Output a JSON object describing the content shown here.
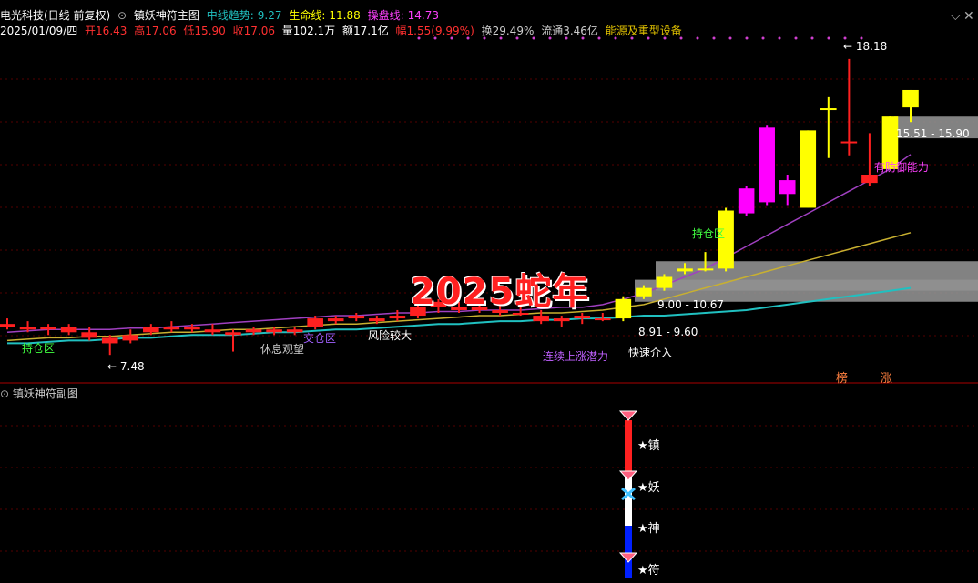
{
  "header": {
    "stock": "电光科技(日线 前复权)",
    "indicator": "镇妖神符主图",
    "mid_trend_label": "中线趋势:",
    "mid_trend_value": "9.27",
    "life_label": "生命线:",
    "life_value": "11.88",
    "op_label": "操盘线:",
    "op_value": "14.73",
    "date": "2025/01/09/四",
    "open": "开16.43",
    "high": "高17.06",
    "low": "低15.90",
    "close": "收17.06",
    "volume": "量102.1万",
    "amount": "额17.1亿",
    "change": "幅1.55(9.99%)",
    "turnover": "换29.49%",
    "float": "流通3.46亿",
    "sector": "能源及重型设备"
  },
  "sub_title": "镇妖神符副图",
  "watermark": "2025蛇年",
  "annotations": {
    "hold_zone_left": "持仓区",
    "hold_zone_right": "持仓区",
    "rest_wait": "休息观望",
    "cross_zone": "交仓区",
    "risk_up": "风险较大",
    "strong_entry": "快速介入",
    "pos_label": "连续上涨潜力",
    "defense": "有防御能力",
    "lowest": "7.48",
    "peak": "18.18",
    "zone_top": "15.51 - 15.90",
    "zone_mid": "9.00 - 10.67",
    "zone_low": "8.91 - 9.60",
    "tag_bang": "榜",
    "tag_zhang": "涨"
  },
  "stars": [
    "★镇",
    "★妖",
    "★神",
    "★符"
  ],
  "colors": {
    "up": "#ff2020",
    "down": "#00c0c0",
    "yellow": "#ffff00",
    "magenta": "#ff00ff",
    "cyan_line": "#20c0c0",
    "gold_line": "#c8b030",
    "purple_line": "#a040c0"
  },
  "chart_data": {
    "type": "candlestick",
    "title": "镇妖神符主图",
    "ylim": [
      6.5,
      19
    ],
    "candles": [
      {
        "o": 8.6,
        "h": 8.8,
        "l": 8.4,
        "c": 8.5,
        "col": "red"
      },
      {
        "o": 8.5,
        "h": 8.7,
        "l": 8.3,
        "c": 8.4,
        "col": "red"
      },
      {
        "o": 8.4,
        "h": 8.6,
        "l": 8.2,
        "c": 8.5,
        "col": "red"
      },
      {
        "o": 8.5,
        "h": 8.6,
        "l": 8.2,
        "c": 8.3,
        "col": "red"
      },
      {
        "o": 8.3,
        "h": 8.5,
        "l": 8.0,
        "c": 8.1,
        "col": "red"
      },
      {
        "o": 8.1,
        "h": 8.2,
        "l": 7.48,
        "c": 7.9,
        "col": "red"
      },
      {
        "o": 8.2,
        "h": 8.4,
        "l": 7.9,
        "c": 8.0,
        "col": "red"
      },
      {
        "o": 8.3,
        "h": 8.6,
        "l": 8.2,
        "c": 8.5,
        "col": "red"
      },
      {
        "o": 8.5,
        "h": 8.7,
        "l": 8.3,
        "c": 8.4,
        "col": "red"
      },
      {
        "o": 8.5,
        "h": 8.6,
        "l": 8.3,
        "c": 8.4,
        "col": "red"
      },
      {
        "o": 8.4,
        "h": 8.6,
        "l": 8.2,
        "c": 8.3,
        "col": "red"
      },
      {
        "o": 8.3,
        "h": 8.4,
        "l": 7.6,
        "c": 8.2,
        "col": "red"
      },
      {
        "o": 8.3,
        "h": 8.5,
        "l": 8.2,
        "c": 8.4,
        "col": "red"
      },
      {
        "o": 8.4,
        "h": 8.5,
        "l": 8.2,
        "c": 8.3,
        "col": "red"
      },
      {
        "o": 8.3,
        "h": 8.5,
        "l": 8.2,
        "c": 8.4,
        "col": "red"
      },
      {
        "o": 8.5,
        "h": 8.9,
        "l": 8.4,
        "c": 8.8,
        "col": "red"
      },
      {
        "o": 8.7,
        "h": 8.9,
        "l": 8.6,
        "c": 8.8,
        "col": "red"
      },
      {
        "o": 8.8,
        "h": 9.0,
        "l": 8.7,
        "c": 8.9,
        "col": "red"
      },
      {
        "o": 8.7,
        "h": 8.9,
        "l": 8.6,
        "c": 8.8,
        "col": "red"
      },
      {
        "o": 8.8,
        "h": 9.1,
        "l": 8.7,
        "c": 8.9,
        "col": "red"
      },
      {
        "o": 8.9,
        "h": 9.3,
        "l": 8.8,
        "c": 9.2,
        "col": "red"
      },
      {
        "o": 9.2,
        "h": 9.5,
        "l": 9.0,
        "c": 9.4,
        "col": "red"
      },
      {
        "o": 9.2,
        "h": 9.4,
        "l": 9.0,
        "c": 9.1,
        "col": "red"
      },
      {
        "o": 9.1,
        "h": 9.3,
        "l": 9.0,
        "c": 9.2,
        "col": "red"
      },
      {
        "o": 9.0,
        "h": 9.3,
        "l": 8.9,
        "c": 9.1,
        "col": "red"
      },
      {
        "o": 9.0,
        "h": 9.2,
        "l": 8.9,
        "c": 9.0,
        "col": "red"
      },
      {
        "o": 8.9,
        "h": 9.1,
        "l": 8.6,
        "c": 8.7,
        "col": "red"
      },
      {
        "o": 8.7,
        "h": 8.9,
        "l": 8.5,
        "c": 8.8,
        "col": "red"
      },
      {
        "o": 8.8,
        "h": 9.0,
        "l": 8.6,
        "c": 8.9,
        "col": "red"
      },
      {
        "o": 8.8,
        "h": 9.0,
        "l": 8.7,
        "c": 8.8,
        "col": "red"
      },
      {
        "o": 8.8,
        "h": 9.6,
        "l": 8.7,
        "c": 9.5,
        "col": "yellow"
      },
      {
        "o": 9.6,
        "h": 10.0,
        "l": 9.5,
        "c": 9.9,
        "col": "yellow"
      },
      {
        "o": 9.9,
        "h": 10.4,
        "l": 9.8,
        "c": 10.3,
        "col": "yellow"
      },
      {
        "o": 10.5,
        "h": 10.8,
        "l": 10.4,
        "c": 10.6,
        "col": "yellow"
      },
      {
        "o": 10.6,
        "h": 11.2,
        "l": 10.5,
        "c": 10.6,
        "col": "yellow"
      },
      {
        "o": 10.6,
        "h": 12.8,
        "l": 10.5,
        "c": 12.7,
        "col": "yellow"
      },
      {
        "o": 12.6,
        "h": 13.6,
        "l": 12.5,
        "c": 13.5,
        "col": "magenta"
      },
      {
        "o": 13.0,
        "h": 15.8,
        "l": 12.9,
        "c": 15.7,
        "col": "magenta"
      },
      {
        "o": 13.3,
        "h": 14.0,
        "l": 12.9,
        "c": 13.8,
        "col": "magenta"
      },
      {
        "o": 12.8,
        "h": 15.6,
        "l": 12.8,
        "c": 15.6,
        "col": "yellow"
      },
      {
        "o": 16.4,
        "h": 16.8,
        "l": 14.6,
        "c": 16.4,
        "col": "yellow"
      },
      {
        "o": 15.2,
        "h": 18.18,
        "l": 14.7,
        "c": 15.2,
        "col": "red"
      },
      {
        "o": 14.0,
        "h": 15.5,
        "l": 13.6,
        "c": 13.7,
        "col": "red"
      },
      {
        "o": 14.2,
        "h": 16.1,
        "l": 14.2,
        "c": 16.1,
        "col": "yellow"
      },
      {
        "o": 16.43,
        "h": 17.06,
        "l": 15.9,
        "c": 17.06,
        "col": "yellow"
      }
    ],
    "lines": {
      "cyan": [
        7.9,
        7.9,
        7.95,
        8.0,
        8.0,
        8.05,
        8.1,
        8.1,
        8.15,
        8.2,
        8.2,
        8.2,
        8.25,
        8.3,
        8.3,
        8.35,
        8.4,
        8.4,
        8.45,
        8.5,
        8.55,
        8.6,
        8.6,
        8.65,
        8.7,
        8.7,
        8.75,
        8.75,
        8.8,
        8.8,
        8.85,
        8.9,
        8.9,
        8.95,
        9.0,
        9.05,
        9.1,
        9.2,
        9.3,
        9.4,
        9.5,
        9.6,
        9.7,
        9.8,
        9.9
      ],
      "gold": [
        8.0,
        8.05,
        8.1,
        8.1,
        8.15,
        8.15,
        8.2,
        8.25,
        8.3,
        8.3,
        8.35,
        8.4,
        8.4,
        8.45,
        8.5,
        8.55,
        8.6,
        8.6,
        8.65,
        8.7,
        8.75,
        8.8,
        8.85,
        8.9,
        8.9,
        8.95,
        9.0,
        9.0,
        9.05,
        9.1,
        9.2,
        9.3,
        9.5,
        9.7,
        9.9,
        10.1,
        10.3,
        10.5,
        10.7,
        10.9,
        11.1,
        11.3,
        11.5,
        11.7,
        11.9
      ],
      "purple": [
        8.3,
        8.35,
        8.4,
        8.4,
        8.4,
        8.4,
        8.45,
        8.45,
        8.5,
        8.55,
        8.6,
        8.65,
        8.7,
        8.75,
        8.8,
        8.85,
        8.9,
        8.9,
        8.95,
        9.0,
        9.0,
        9.05,
        9.05,
        9.1,
        9.1,
        9.1,
        9.15,
        9.2,
        9.2,
        9.3,
        9.5,
        9.7,
        10.0,
        10.3,
        10.6,
        11.0,
        11.4,
        11.8,
        12.2,
        12.6,
        13.0,
        13.4,
        13.8,
        14.2,
        14.73
      ]
    },
    "zones": [
      {
        "lo": 15.51,
        "hi": 15.9
      },
      {
        "lo": 10.0,
        "hi": 10.67
      },
      {
        "lo": 9.6,
        "hi": 10.0
      }
    ]
  }
}
